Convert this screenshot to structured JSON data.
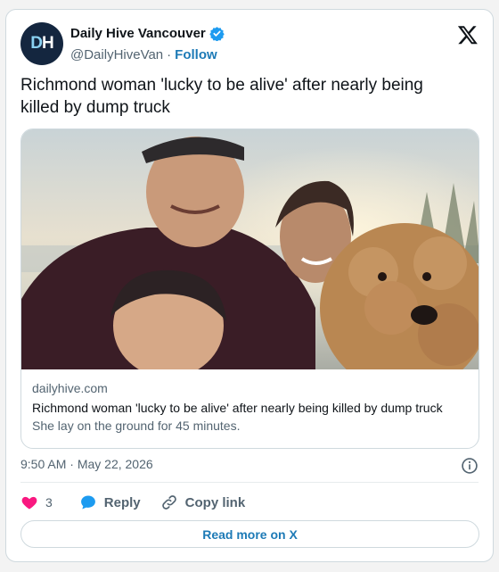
{
  "author": {
    "avatar_text": "DH",
    "display_name": "Daily Hive Vancouver",
    "handle": "@DailyHiveVan",
    "separator": "·",
    "follow_label": "Follow"
  },
  "tweet": {
    "text": "Richmond woman 'lucky to be alive' after nearly being killed by dump truck"
  },
  "link_card": {
    "domain": "dailyhive.com",
    "title": "Richmond woman 'lucky to be alive' after nearly being killed by dump truck",
    "description": "She lay on the ground for 45 minutes."
  },
  "timestamp": {
    "time": "9:50 AM",
    "separator": "·",
    "date": "May 22, 2026"
  },
  "actions": {
    "like_count": "3",
    "reply_label": "Reply",
    "copy_link_label": "Copy link"
  },
  "read_more_label": "Read more on X",
  "colors": {
    "link_blue": "#1d7ab6",
    "heart": "#f91880",
    "reply_bubble": "#1d9bf0",
    "verified": "#1d9bf0",
    "avatar_bg": "#14263f"
  },
  "icons": {
    "verified": "verified-badge-icon",
    "x_logo": "x-logo-icon",
    "info": "info-icon",
    "like": "heart-icon",
    "reply": "reply-bubble-icon",
    "copy": "link-icon"
  }
}
